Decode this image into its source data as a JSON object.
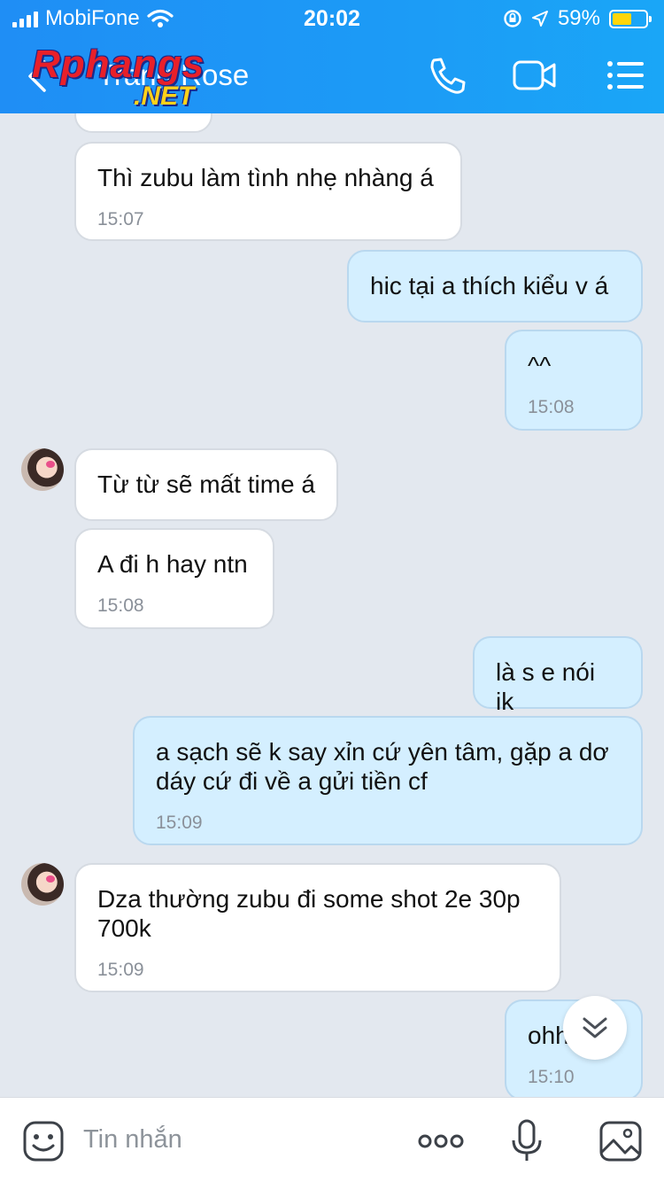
{
  "status_bar": {
    "carrier": "MobiFone",
    "time": "20:02",
    "battery": "59%",
    "battery_level": 0.59
  },
  "header": {
    "contact_name": "Trang Rose",
    "watermark_main": "Rphangs",
    "watermark_sub": ".NET",
    "icons": [
      "back-icon",
      "phone-icon",
      "video-call-icon",
      "menu-icon"
    ]
  },
  "messages": [
    {
      "side": "in",
      "text": "",
      "time": ""
    },
    {
      "side": "in",
      "text": "Thì zubu làm tình nhẹ nhàng á",
      "time": "15:07"
    },
    {
      "side": "out",
      "text": "hic tại a thích kiểu v á",
      "time": ""
    },
    {
      "side": "out",
      "text": "^^",
      "time": "15:08"
    },
    {
      "side": "in",
      "text": "Từ từ sẽ mất time á",
      "time": ""
    },
    {
      "side": "in",
      "text": "A đi h hay ntn",
      "time": "15:08"
    },
    {
      "side": "out",
      "text": "là s e nói ik",
      "time": ""
    },
    {
      "side": "out",
      "text": "a sạch sẽ k say xỉn cứ yên tâm, gặp a dơ dáy cứ đi về a gửi tiền cf",
      "time": "15:09"
    },
    {
      "side": "in",
      "text": "Dza thường zubu đi some shot 2e 30p 700k",
      "time": "15:09"
    },
    {
      "side": "out",
      "text": "ohh",
      "time": "15:10"
    }
  ],
  "input": {
    "placeholder": "Tin nhắn"
  },
  "colors": {
    "header": "#1c9bf6",
    "incoming_bubble": "#ffffff",
    "outgoing_bubble": "#d4efff",
    "chat_background": "#e3e8ef"
  }
}
